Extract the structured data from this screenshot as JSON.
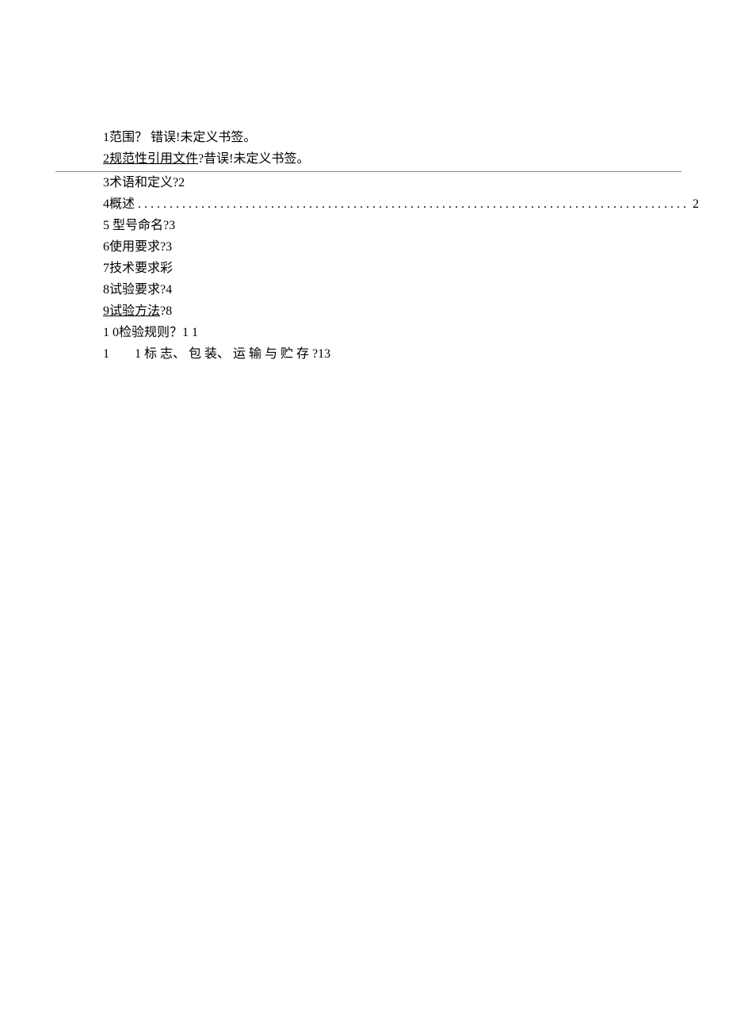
{
  "toc": {
    "line1": "1范围？ 错误!未定义书签。",
    "line2_underline": "2规范性引用文件",
    "line2_rest": "?昔误!未定义书签。",
    "line3": "3术语和定义?2",
    "line4_prefix": "4概述 ",
    "line4_dots": ". . . . . . . . . . . . . . . . . . . . . . . . . . . . . . . . . . . . . . . . . . . . . . . . . . . . . . . . . . . . . . . . . . . . . . . . . . . . . . . . . . . . . . .",
    "line4_page": "2",
    "line5": "5 型号命名?3",
    "line6": "6使用要求?3",
    "line7": "7技术要求彩",
    "line8": "8试验要求?4",
    "line9_underline": "9试验方法",
    "line9_rest": "?8",
    "line10": "1 0检验规则？1 1",
    "line11": "1　　1 标 志、 包 装、 运 输 与 贮 存 ?13"
  }
}
